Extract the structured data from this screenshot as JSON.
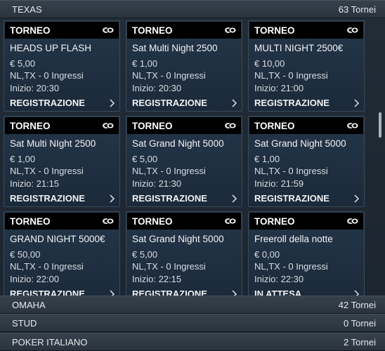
{
  "sections": [
    {
      "name": "TEXAS",
      "count": "63 Tornei"
    },
    {
      "name": "OMAHA",
      "count": "42 Tornei"
    },
    {
      "name": "STUD",
      "count": "0 Tornei"
    },
    {
      "name": "POKER ITALIANO",
      "count": "2 Tornei"
    }
  ],
  "cards": [
    {
      "header": "TORNEO",
      "title": "HEADS UP FLASH",
      "price": "€ 5,00",
      "type": "NL,TX - 0 Ingressi",
      "start": "Inizio: 20:30",
      "action": "REGISTRAZIONE"
    },
    {
      "header": "TORNEO",
      "title": "Sat Multi Night 2500",
      "price": "€ 1,00",
      "type": "NL,TX - 0 Ingressi",
      "start": "Inizio: 20:30",
      "action": "REGISTRAZIONE"
    },
    {
      "header": "TORNEO",
      "title": "MULTI NIGHT 2500€",
      "price": "€ 10,00",
      "type": "NL,TX - 0 Ingressi",
      "start": "Inizio: 21:00",
      "action": "REGISTRAZIONE"
    },
    {
      "header": "TORNEO",
      "title": "Sat Multi NIght 2500",
      "price": "€ 1,00",
      "type": "NL,TX - 0 Ingressi",
      "start": "Inizio: 21:15",
      "action": "REGISTRAZIONE"
    },
    {
      "header": "TORNEO",
      "title": "Sat Grand Night 5000",
      "price": "€ 5,00",
      "type": "NL,TX - 0 Ingressi",
      "start": "Inizio: 21:30",
      "action": "REGISTRAZIONE"
    },
    {
      "header": "TORNEO",
      "title": "Sat Grand Night 5000",
      "price": "€ 1,00",
      "type": "NL,TX - 0 Ingressi",
      "start": "Inizio: 21:59",
      "action": "REGISTRAZIONE"
    },
    {
      "header": "TORNEO",
      "title": "GRAND NIGHT 5000€",
      "price": "€ 50,00",
      "type": "NL,TX - 0 Ingressi",
      "start": "Inizio: 22:00",
      "action": "REGISTRAZIONE"
    },
    {
      "header": "TORNEO",
      "title": "Sat Grand Night 5000",
      "price": "€ 5,00",
      "type": "NL,TX - 0 Ingressi",
      "start": "Inizio: 22:15",
      "action": "REGISTRAZIONE"
    },
    {
      "header": "TORNEO",
      "title": "Freeroll della notte",
      "price": "€ 0,00",
      "type": "NL,TX - 0 Ingressi",
      "start": "Inizio: 22:30",
      "action": "IN ATTESA"
    }
  ],
  "icons": {
    "card_icon": "poker-chips-icon",
    "action_icon": "chevron-right-icon"
  },
  "colors": {
    "card_header": "#000000",
    "card_bg": "#1f3042",
    "section_bg": "#303b46"
  }
}
